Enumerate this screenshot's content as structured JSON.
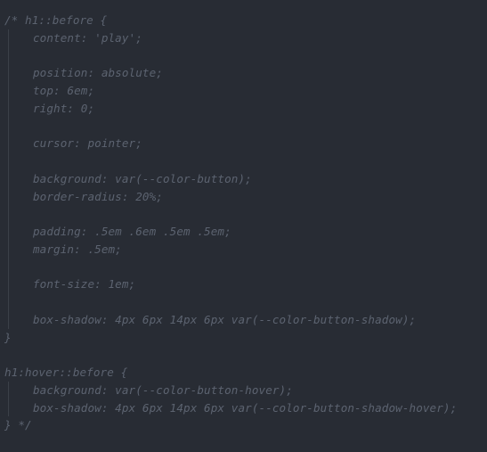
{
  "editor": {
    "lines": [
      {
        "text": "/* h1::before {",
        "indent": false
      },
      {
        "text": "content: 'play';",
        "indent": true
      },
      {
        "text": "",
        "indent": true
      },
      {
        "text": "position: absolute;",
        "indent": true
      },
      {
        "text": "top: 6em;",
        "indent": true
      },
      {
        "text": "right: 0;",
        "indent": true
      },
      {
        "text": "",
        "indent": true
      },
      {
        "text": "cursor: pointer;",
        "indent": true
      },
      {
        "text": "",
        "indent": true
      },
      {
        "text": "background: var(--color-button);",
        "indent": true
      },
      {
        "text": "border-radius: 20%;",
        "indent": true
      },
      {
        "text": "",
        "indent": true
      },
      {
        "text": "padding: .5em .6em .5em .5em;",
        "indent": true
      },
      {
        "text": "margin: .5em;",
        "indent": true
      },
      {
        "text": "",
        "indent": true
      },
      {
        "text": "font-size: 1em;",
        "indent": true
      },
      {
        "text": "",
        "indent": true
      },
      {
        "text": "box-shadow: 4px 6px 14px 6px var(--color-button-shadow);",
        "indent": true
      },
      {
        "text": "}",
        "indent": false
      },
      {
        "text": "",
        "indent": false
      },
      {
        "text": "h1:hover::before {",
        "indent": false
      },
      {
        "text": "background: var(--color-button-hover);",
        "indent": true
      },
      {
        "text": "box-shadow: 4px 6px 14px 6px var(--color-button-shadow-hover);",
        "indent": true
      },
      {
        "text": "} */",
        "indent": false
      }
    ]
  },
  "colors": {
    "background": "#282c34",
    "comment": "#5c6370",
    "indent_guide": "#3b4048"
  }
}
